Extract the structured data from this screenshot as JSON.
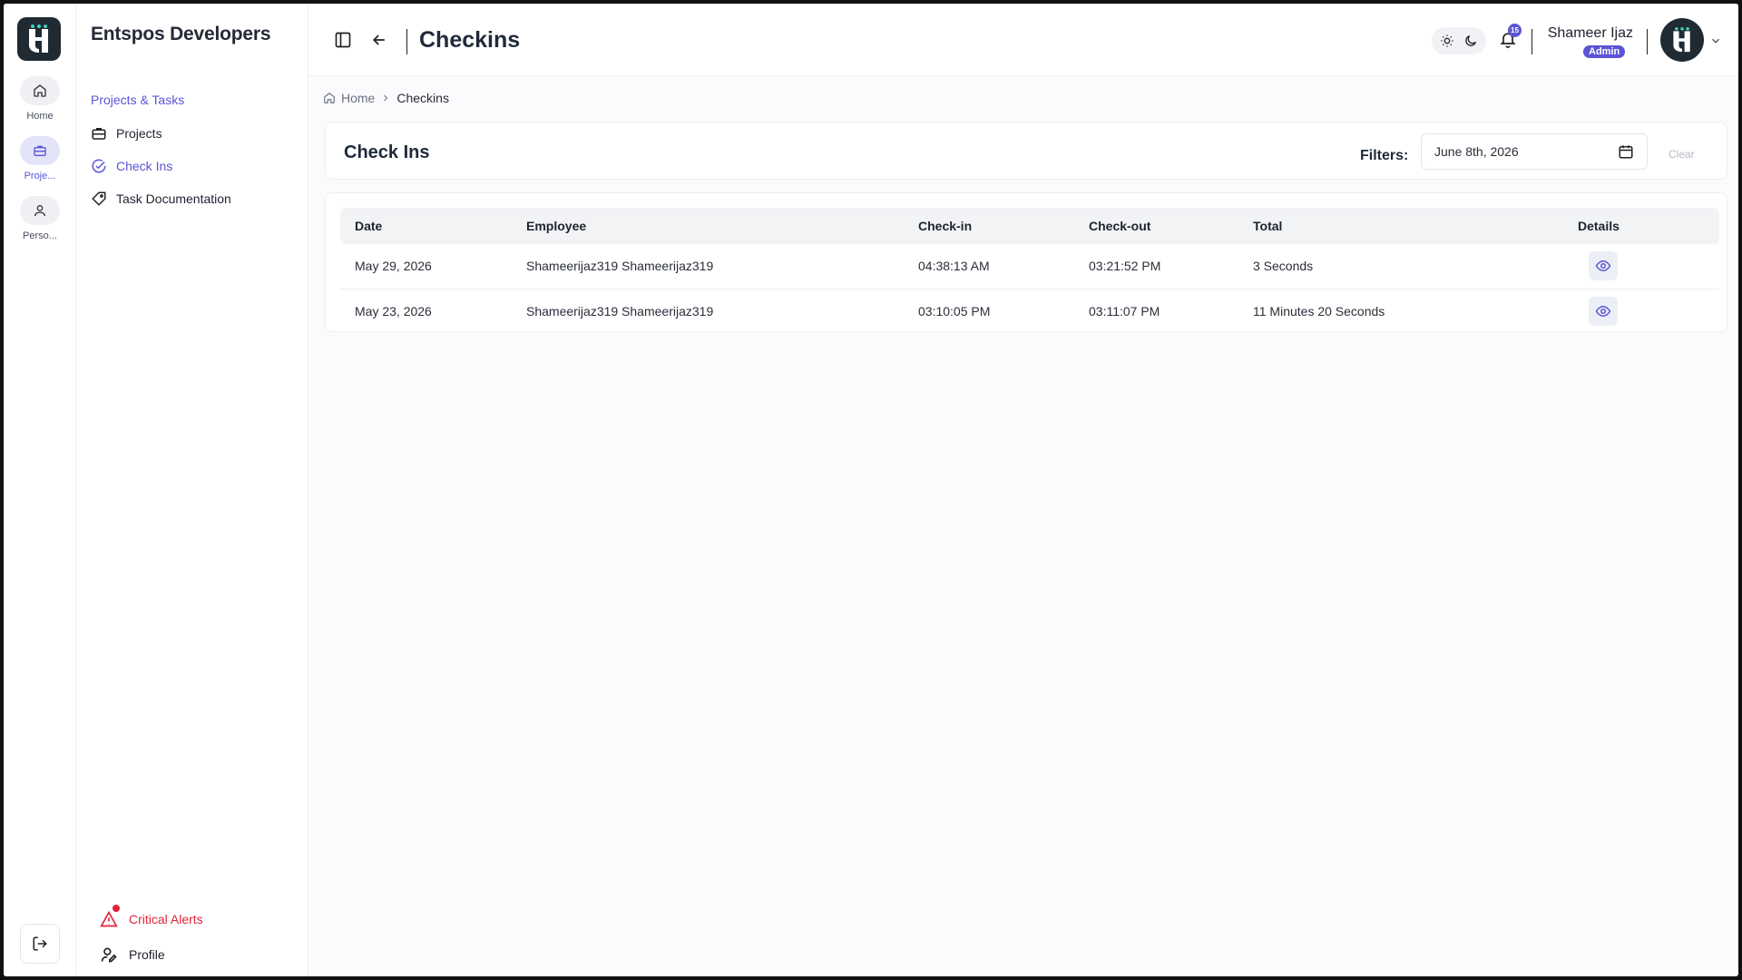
{
  "rail": {
    "items": [
      {
        "label": "Home",
        "icon": "home-icon"
      },
      {
        "label": "Proje...",
        "icon": "briefcase-icon"
      },
      {
        "label": "Perso...",
        "icon": "person-icon"
      }
    ]
  },
  "sidebar": {
    "org": "Entspos Developers",
    "section": "Projects & Tasks",
    "items": [
      {
        "label": "Projects",
        "icon": "briefcase-icon"
      },
      {
        "label": "Check Ins",
        "icon": "check-circle-icon"
      },
      {
        "label": "Task Documentation",
        "icon": "tag-icon"
      }
    ],
    "alerts": "Critical Alerts",
    "profile": "Profile"
  },
  "header": {
    "title": "Checkins",
    "notification_count": "15",
    "user_name": "Shameer Ijaz",
    "role": "Admin"
  },
  "breadcrumb": {
    "home": "Home",
    "current": "Checkins"
  },
  "panel": {
    "title": "Check Ins",
    "filters_label": "Filters:",
    "date_value": "June 8th, 2026",
    "clear_label": "Clear"
  },
  "table": {
    "headers": [
      "Date",
      "Employee",
      "Check-in",
      "Check-out",
      "Total",
      "Details"
    ],
    "rows": [
      {
        "date": "May 29, 2026",
        "employee": "Shameerijaz319 Shameerijaz319",
        "checkin": "04:38:13 AM",
        "checkout": "03:21:52 PM",
        "total": "3 Seconds"
      },
      {
        "date": "May 23, 2026",
        "employee": "Shameerijaz319 Shameerijaz319",
        "checkin": "03:10:05 PM",
        "checkout": "03:11:07 PM",
        "total": "11 Minutes 20 Seconds"
      }
    ]
  },
  "colors": {
    "accent": "#5b55d6",
    "danger": "#e0243a",
    "logo_bg": "#1f2a32"
  }
}
